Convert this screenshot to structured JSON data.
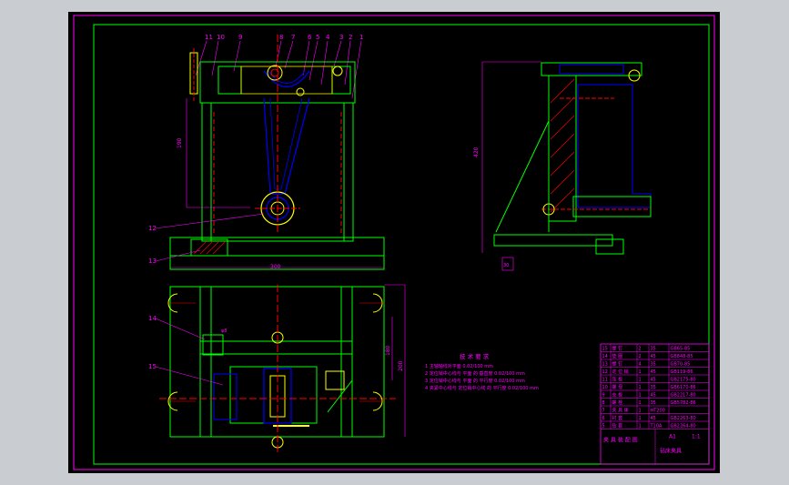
{
  "drawing": {
    "background": "#000000",
    "frame_color": "#ff00ff",
    "line_green": "#00ff00",
    "line_blue": "#0000ff",
    "line_yellow": "#ffff00",
    "line_red": "#ff0000",
    "hatch_color": "#ff0000"
  },
  "balloons": [
    "11",
    "10",
    "9",
    "8",
    "7",
    "6",
    "5",
    "4",
    "3",
    "2",
    "1"
  ],
  "balloon_12": "12",
  "balloon_13": "13",
  "balloon_14": "14",
  "balloon_15": "15",
  "dims": {
    "front_width": "300",
    "front_height": "190",
    "top_height": "200",
    "top_width": "180",
    "side_height": "420",
    "small": "30"
  },
  "tech_requirements": {
    "title": "技 术 要 求",
    "items": [
      "1  主轴轴线对平面 0.02/100 mm",
      "2  定位销中心线与 平面 的 垂直度 0.02/100 mm",
      "3  定位销中心线与 平面 的 平行度 0.02/100 mm",
      "4  夹紧中心线与 定位销中心线 的 平行度 0.02/100 mm"
    ]
  },
  "title_block": {
    "rows": [
      {
        "no": "15",
        "name": "螺 钉",
        "qty": "2",
        "mat": "35",
        "std": "GB65-85"
      },
      {
        "no": "14",
        "name": "垫 圈",
        "qty": "2",
        "mat": "45",
        "std": "GB848-85"
      },
      {
        "no": "13",
        "name": "螺 钉",
        "qty": "4",
        "mat": "35",
        "std": "GB70-85"
      },
      {
        "no": "12",
        "name": "定 位 销",
        "qty": "1",
        "mat": "45",
        "std": "GB119-86"
      },
      {
        "no": "11",
        "name": "压 板",
        "qty": "1",
        "mat": "45",
        "std": "GB2175-80"
      },
      {
        "no": "10",
        "name": "螺 母",
        "qty": "1",
        "mat": "35",
        "std": "GB6170-86"
      },
      {
        "no": "9",
        "name": "支 板",
        "qty": "1",
        "mat": "45",
        "std": "GB2217-80"
      },
      {
        "no": "8",
        "name": "螺 栓",
        "qty": "1",
        "mat": "35",
        "std": "GB5782-86"
      },
      {
        "no": "7",
        "name": "夹 具 体",
        "qty": "1",
        "mat": "HT200",
        "std": ""
      },
      {
        "no": "6",
        "name": "衬 套",
        "qty": "1",
        "mat": "45",
        "std": "GB2263-80"
      },
      {
        "no": "5",
        "name": "钻 套",
        "qty": "1",
        "mat": "T10A",
        "std": "GB2264-80"
      }
    ],
    "title": "钻床夹具",
    "scale": "1:1",
    "sheet": "A1",
    "company": "夹 具 装 配 图"
  }
}
